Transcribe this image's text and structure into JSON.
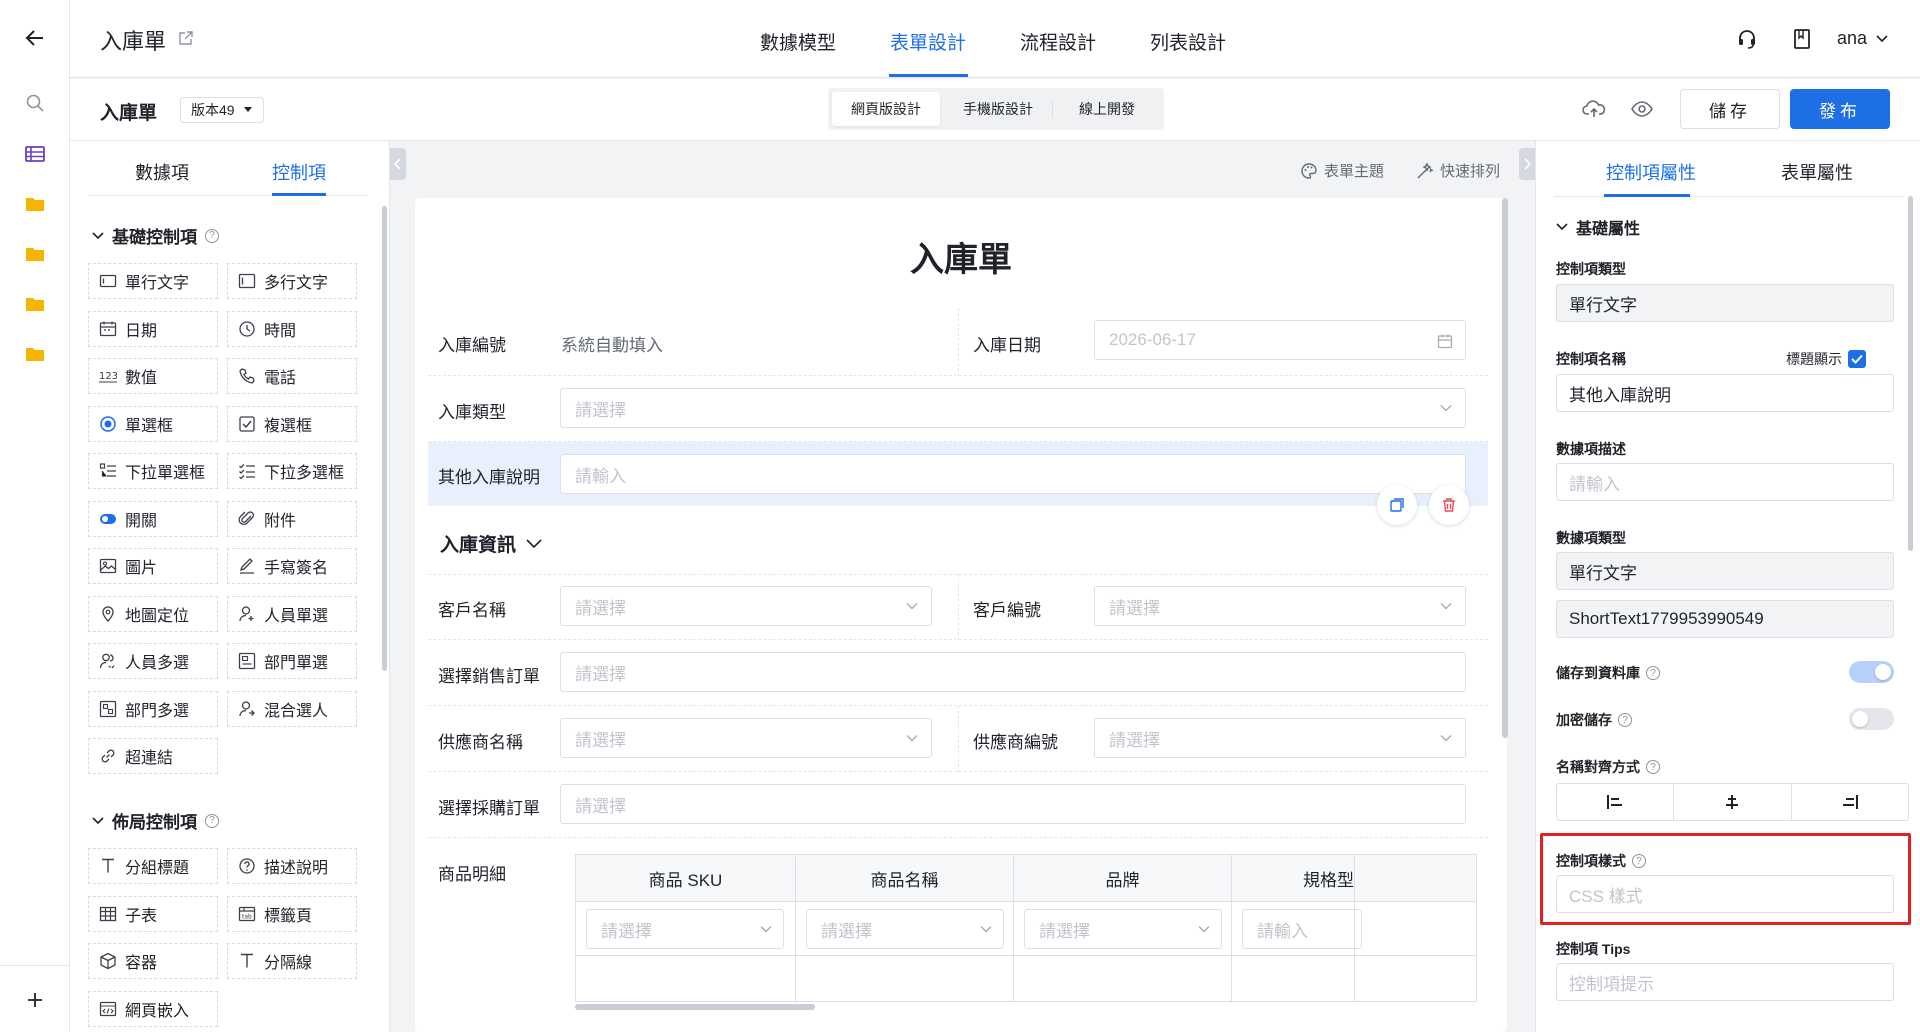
{
  "header": {
    "form_title": "入庫單",
    "tabs": [
      {
        "label": "數據模型"
      },
      {
        "label": "表單設計"
      },
      {
        "label": "流程設計"
      },
      {
        "label": "列表設計"
      }
    ],
    "user": "ana"
  },
  "subbar": {
    "title": "入庫單",
    "version": "版本49",
    "modes": [
      {
        "label": "網頁版設計"
      },
      {
        "label": "手機版設計"
      },
      {
        "label": "線上開發"
      }
    ],
    "save_label": "儲存",
    "publish_label": "發布"
  },
  "left_panel": {
    "tabs": [
      {
        "label": "數據項"
      },
      {
        "label": "控制項"
      }
    ],
    "basic_section": "基礎控制項",
    "basic_items": [
      {
        "label": "單行文字",
        "icon": "single-line-text-icon"
      },
      {
        "label": "多行文字",
        "icon": "multi-line-text-icon"
      },
      {
        "label": "日期",
        "icon": "calendar-icon"
      },
      {
        "label": "時間",
        "icon": "clock-icon"
      },
      {
        "label": "數值",
        "icon": "number-icon"
      },
      {
        "label": "電話",
        "icon": "phone-icon"
      },
      {
        "label": "單選框",
        "icon": "radio-icon"
      },
      {
        "label": "複選框",
        "icon": "checkbox-icon"
      },
      {
        "label": "下拉單選框",
        "icon": "dropdown-single-icon"
      },
      {
        "label": "下拉多選框",
        "icon": "dropdown-multi-icon"
      },
      {
        "label": "開關",
        "icon": "switch-icon"
      },
      {
        "label": "附件",
        "icon": "paperclip-icon"
      },
      {
        "label": "圖片",
        "icon": "image-icon"
      },
      {
        "label": "手寫簽名",
        "icon": "pen-icon"
      },
      {
        "label": "地圖定位",
        "icon": "location-pin-icon"
      },
      {
        "label": "人員單選",
        "icon": "user-icon"
      },
      {
        "label": "人員多選",
        "icon": "users-icon"
      },
      {
        "label": "部門單選",
        "icon": "department-icon"
      },
      {
        "label": "部門多選",
        "icon": "departments-icon"
      },
      {
        "label": "混合選人",
        "icon": "mixed-user-icon"
      },
      {
        "label": "超連結",
        "icon": "link-icon"
      }
    ],
    "layout_section": "佈局控制項",
    "layout_items": [
      {
        "label": "分組標題",
        "icon": "group-title-icon"
      },
      {
        "label": "描述說明",
        "icon": "help-circle-icon"
      },
      {
        "label": "子表",
        "icon": "table-icon"
      },
      {
        "label": "標籤頁",
        "icon": "tabs-icon"
      },
      {
        "label": "容器",
        "icon": "box-icon"
      },
      {
        "label": "分隔線",
        "icon": "divider-icon"
      },
      {
        "label": "網頁嵌入",
        "icon": "embed-icon"
      }
    ]
  },
  "canvas": {
    "theme_label": "表單主題",
    "arrange_label": "快速排列",
    "form_heading": "入庫單",
    "fields": {
      "inbound_no_label": "入庫編號",
      "inbound_no_value": "系統自動填入",
      "inbound_date_label": "入庫日期",
      "inbound_date_value": "2026-06-17",
      "inbound_type_label": "入庫類型",
      "other_desc_label": "其他入庫說明",
      "section_title": "入庫資訊",
      "customer_name_label": "客戶名稱",
      "customer_no_label": "客戶編號",
      "sales_order_label": "選擇銷售訂單",
      "supplier_name_label": "供應商名稱",
      "supplier_no_label": "供應商編號",
      "purchase_order_label": "選擇採購訂單",
      "items_label": "商品明細"
    },
    "placeholder_select": "請選擇",
    "placeholder_input": "請輸入",
    "subtable": {
      "headers": [
        "商品 SKU",
        "商品名稱",
        "品牌",
        "規格型"
      ]
    }
  },
  "right_panel": {
    "tabs": [
      {
        "label": "控制項屬性"
      },
      {
        "label": "表單屬性"
      }
    ],
    "section": "基礎屬性",
    "control_type_label": "控制項類型",
    "control_type_value": "單行文字",
    "control_name_label": "控制項名稱",
    "title_display_label": "標題顯示",
    "control_name_value": "其他入庫說明",
    "data_desc_label": "數據項描述",
    "data_desc_placeholder": "請輸入",
    "data_type_label": "數據項類型",
    "data_type_value": "單行文字",
    "data_code_value": "ShortText1779953990549",
    "save_db_label": "儲存到資料庫",
    "save_db_on": true,
    "encrypt_label": "加密儲存",
    "encrypt_on": false,
    "align_label": "名稱對齊方式",
    "style_label": "控制項樣式",
    "style_placeholder": "CSS 樣式",
    "tips_label": "控制項 Tips",
    "tips_placeholder": "控制項提示"
  },
  "colors": {
    "accent": "#1e6fe6",
    "selected_row": "#e8f0fd",
    "delete": "#e34d59",
    "highlight": "#e32020"
  }
}
